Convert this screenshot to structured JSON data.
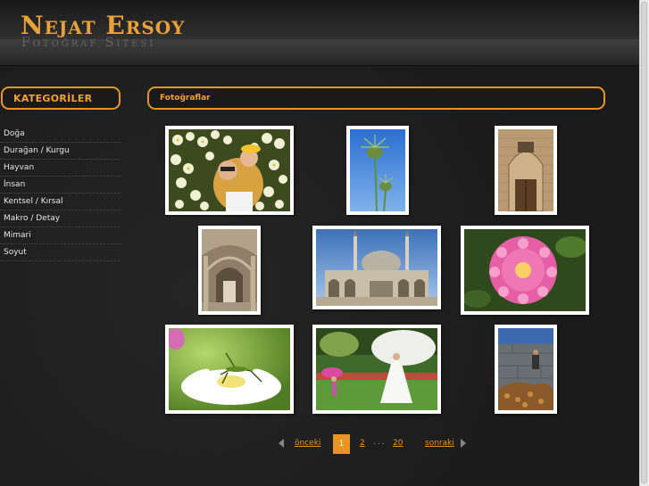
{
  "site": {
    "title": "Nejat Ersoy",
    "subtitle": "Fotoğraf Sitesi"
  },
  "sidebar": {
    "heading": "KATEGORİLER",
    "items": [
      {
        "label": "Doğa"
      },
      {
        "label": "Durağan / Kurgu"
      },
      {
        "label": "Hayvan"
      },
      {
        "label": "İnsan"
      },
      {
        "label": "Kentsel / Kırsal"
      },
      {
        "label": "Makro / Detay"
      },
      {
        "label": "Mimari"
      },
      {
        "label": "Soyut"
      }
    ]
  },
  "main": {
    "heading": "Fotoğraflar",
    "photos": [
      {
        "subject": "flowers-portrait"
      },
      {
        "subject": "blue-thistle"
      },
      {
        "subject": "mosque-door"
      },
      {
        "subject": "arched-colonnade"
      },
      {
        "subject": "mosque-courtyard"
      },
      {
        "subject": "pink-daisy"
      },
      {
        "subject": "grasshopper-flower"
      },
      {
        "subject": "bride-garden"
      },
      {
        "subject": "leaves-stone-wall"
      }
    ]
  },
  "pager": {
    "prev_label": "önceki",
    "current": "1",
    "next_page": "2",
    "ellipsis": "...",
    "last_page": "20",
    "next_label": "sonraki"
  },
  "colors": {
    "accent": "#e8951f",
    "background": "#1c1c1c"
  }
}
